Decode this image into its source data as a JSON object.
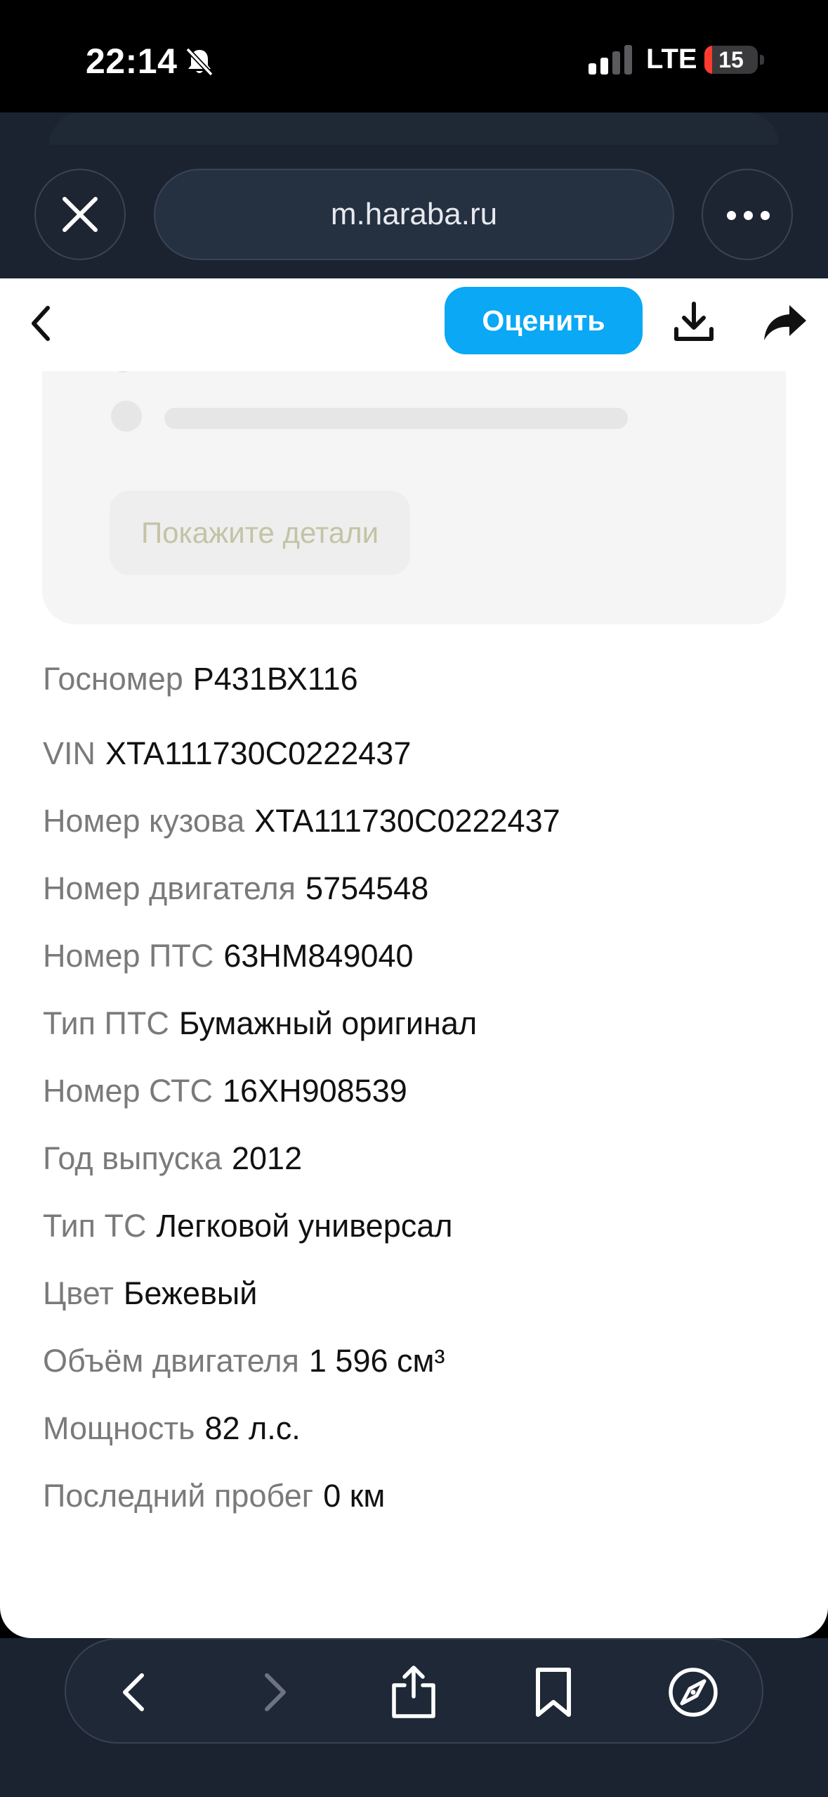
{
  "status_bar": {
    "time": "22:14",
    "network": "LTE",
    "battery": "15",
    "battery_level": 0.15,
    "icons": [
      "bell-slash-icon",
      "signal-icon",
      "battery-icon"
    ]
  },
  "browser": {
    "url": "m.haraba.ru",
    "icons": [
      "close-icon",
      "more-icon"
    ]
  },
  "toolbar": {
    "rate_label": "Оценить",
    "accent_color": "#0aa8f5",
    "icons": [
      "chevron-left-icon",
      "download-icon",
      "share-icon"
    ]
  },
  "details_card": {
    "button_label": "Покажите детали"
  },
  "vehicle_info": [
    {
      "label": "Госномер",
      "value": "Р431ВХ116"
    },
    {
      "label": "VIN",
      "value": "XTA111730C0222437"
    },
    {
      "label": "Номер кузова",
      "value": "XTA111730C0222437"
    },
    {
      "label": "Номер двигателя",
      "value": "5754548"
    },
    {
      "label": "Номер ПТС",
      "value": "63НМ849040"
    },
    {
      "label": "Тип ПТС",
      "value": "Бумажный оригинал"
    },
    {
      "label": "Номер СТС",
      "value": "16ХН908539"
    },
    {
      "label": "Год выпуска",
      "value": "2012"
    },
    {
      "label": "Тип ТС",
      "value": "Легковой универсал"
    },
    {
      "label": "Цвет",
      "value": "Бежевый"
    },
    {
      "label": "Объём двигателя",
      "value": "1 596 см³"
    },
    {
      "label": "Мощность",
      "value": "82 л.с."
    },
    {
      "label": "Последний пробег",
      "value": "0 км"
    }
  ],
  "bottom_bar": {
    "icons": [
      "back-icon",
      "forward-icon",
      "share-icon",
      "bookmarks-icon",
      "compass-icon"
    ]
  }
}
